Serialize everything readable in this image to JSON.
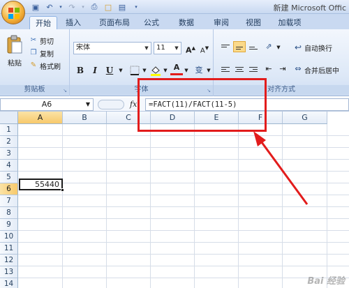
{
  "window": {
    "title": "新建 Microsoft Offic"
  },
  "tabs": [
    {
      "label": "开始",
      "active": true
    },
    {
      "label": "插入"
    },
    {
      "label": "页面布局"
    },
    {
      "label": "公式"
    },
    {
      "label": "数据"
    },
    {
      "label": "审阅"
    },
    {
      "label": "视图"
    },
    {
      "label": "加载项"
    }
  ],
  "clipboard": {
    "group_label": "剪贴板",
    "paste_label": "粘贴",
    "cut_label": "剪切",
    "copy_label": "复制",
    "format_painter_label": "格式刷"
  },
  "font": {
    "group_label": "字体",
    "font_name": "宋体",
    "font_size": "11",
    "grow_label": "A",
    "shrink_label": "A",
    "bold": "B",
    "italic": "I",
    "underline": "U",
    "font_color_label": "A",
    "phonetic_label": "变"
  },
  "alignment": {
    "group_label": "对齐方式",
    "wrap_text_label": "自动换行",
    "merge_center_label": "合并后居中"
  },
  "formula_bar": {
    "name_box": "A6",
    "fx": "fx",
    "formula": "=FACT(11)/FACT(11-5)"
  },
  "sheet": {
    "columns": [
      "A",
      "B",
      "C",
      "D",
      "E",
      "F",
      "G"
    ],
    "rows": [
      "1",
      "2",
      "3",
      "4",
      "5",
      "6",
      "7",
      "8",
      "9",
      "10",
      "11",
      "12",
      "13",
      "14"
    ],
    "active_cell_value": "55440",
    "selected_column": "A",
    "selected_row": "6"
  },
  "watermark": "Bai 经验",
  "colors": {
    "annotation_red": "#e21c1c",
    "ribbon_blue": "#dde8f7"
  }
}
